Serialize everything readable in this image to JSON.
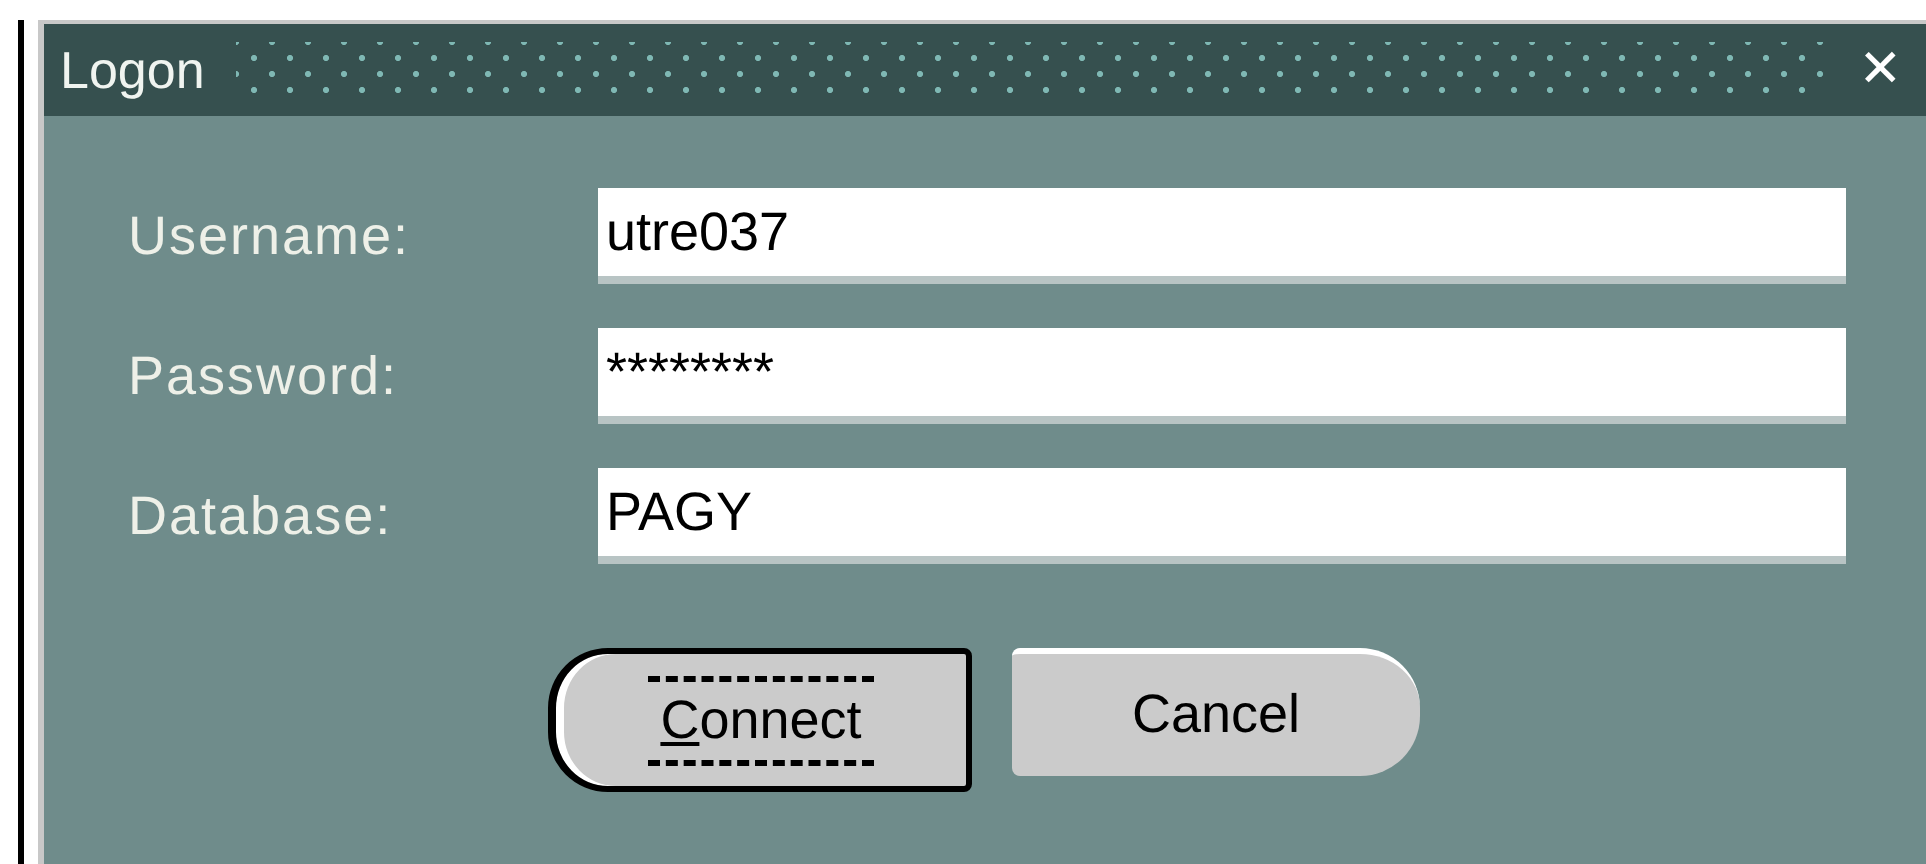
{
  "window": {
    "title": "Logon",
    "close": "✕"
  },
  "fields": [
    {
      "label": "Username:",
      "value": "utre037"
    },
    {
      "label": "Password:",
      "value": "********"
    },
    {
      "label": "Database:",
      "value": "PAGY"
    }
  ],
  "buttons": [
    {
      "label": "Connect",
      "default": true,
      "mnemonic_underlined": true
    },
    {
      "label": "Cancel",
      "default": false
    }
  ]
}
